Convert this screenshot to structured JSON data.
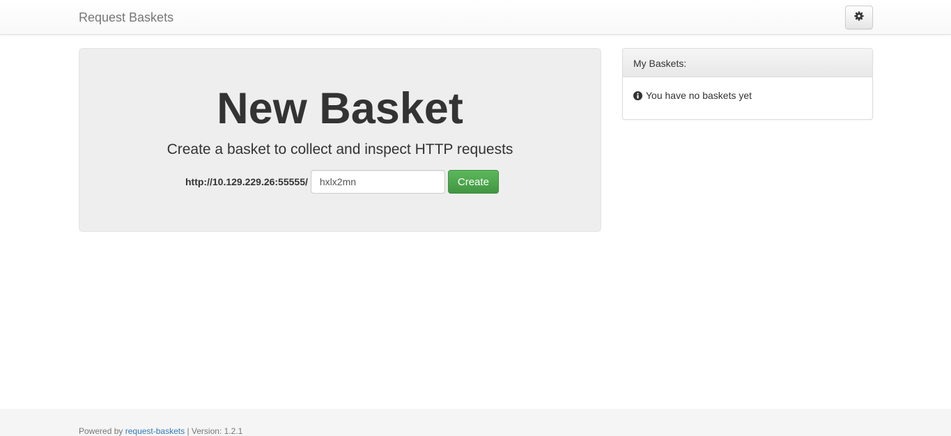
{
  "navbar": {
    "brand": "Request Baskets",
    "settings_icon": "gear-icon"
  },
  "jumbotron": {
    "title": "New Basket",
    "subtitle": "Create a basket to collect and inspect HTTP requests",
    "url_prefix": "http://10.129.229.26:55555/",
    "basket_name_value": "hxlx2mn",
    "create_label": "Create"
  },
  "sidebar": {
    "heading": "My Baskets:",
    "empty_icon": "info-circle-icon",
    "empty_message": "You have no baskets yet"
  },
  "footer": {
    "powered_by": "Powered by",
    "link_text": "request-baskets",
    "version_text": "| Version: 1.2.1"
  },
  "colors": {
    "accent_green": "#5cb85c",
    "link_blue": "#337ab7",
    "jumbotron_bg": "#eeeeee"
  }
}
